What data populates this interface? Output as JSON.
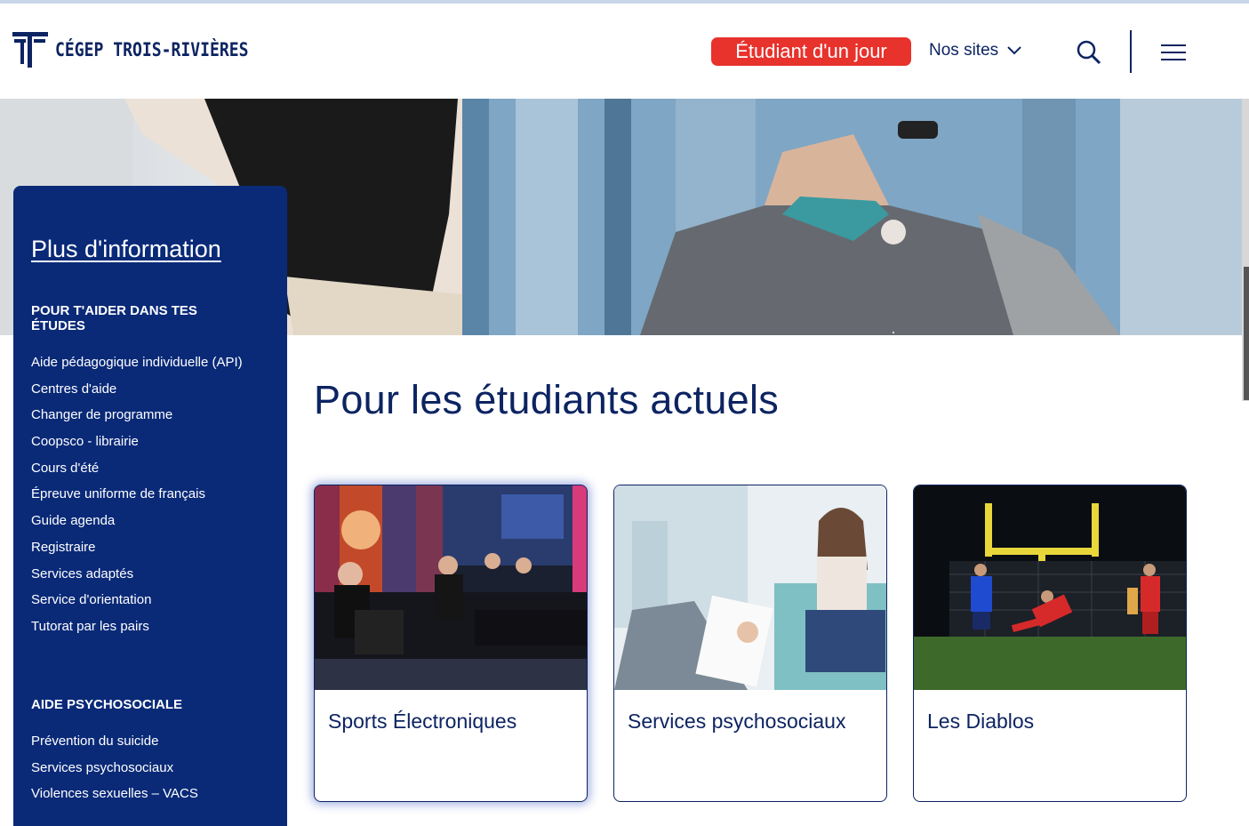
{
  "header": {
    "logo_text": "CÉGEP TROIS-RIVIÈRES",
    "cta_label": "Étudiant d'un jour",
    "nos_sites_label": "Nos sites"
  },
  "sidebar": {
    "title": "Plus d'information",
    "section1": {
      "heading": "POUR T'AIDER DANS TES ÉTUDES",
      "items": [
        "Aide pédagogique individuelle (API)",
        "Centres d'aide",
        "Changer de programme",
        "Coopsco - librairie",
        "Cours d'été",
        "Épreuve uniforme de français",
        "Guide agenda",
        "Registraire",
        "Services adaptés",
        "Service d'orientation",
        "Tutorat par les pairs"
      ]
    },
    "section2": {
      "heading": "AIDE PSYCHOSOCIALE",
      "items": [
        "Prévention du suicide",
        "Services psychosociaux",
        "Violences sexuelles – VACS"
      ]
    }
  },
  "main": {
    "title": "Pour les étudiants actuels",
    "cards": [
      {
        "label": "Sports Électroniques"
      },
      {
        "label": "Services psychosociaux"
      },
      {
        "label": "Les Diablos"
      }
    ]
  },
  "colors": {
    "brand_navy": "#0a2a78",
    "cta_red": "#e8322c"
  }
}
